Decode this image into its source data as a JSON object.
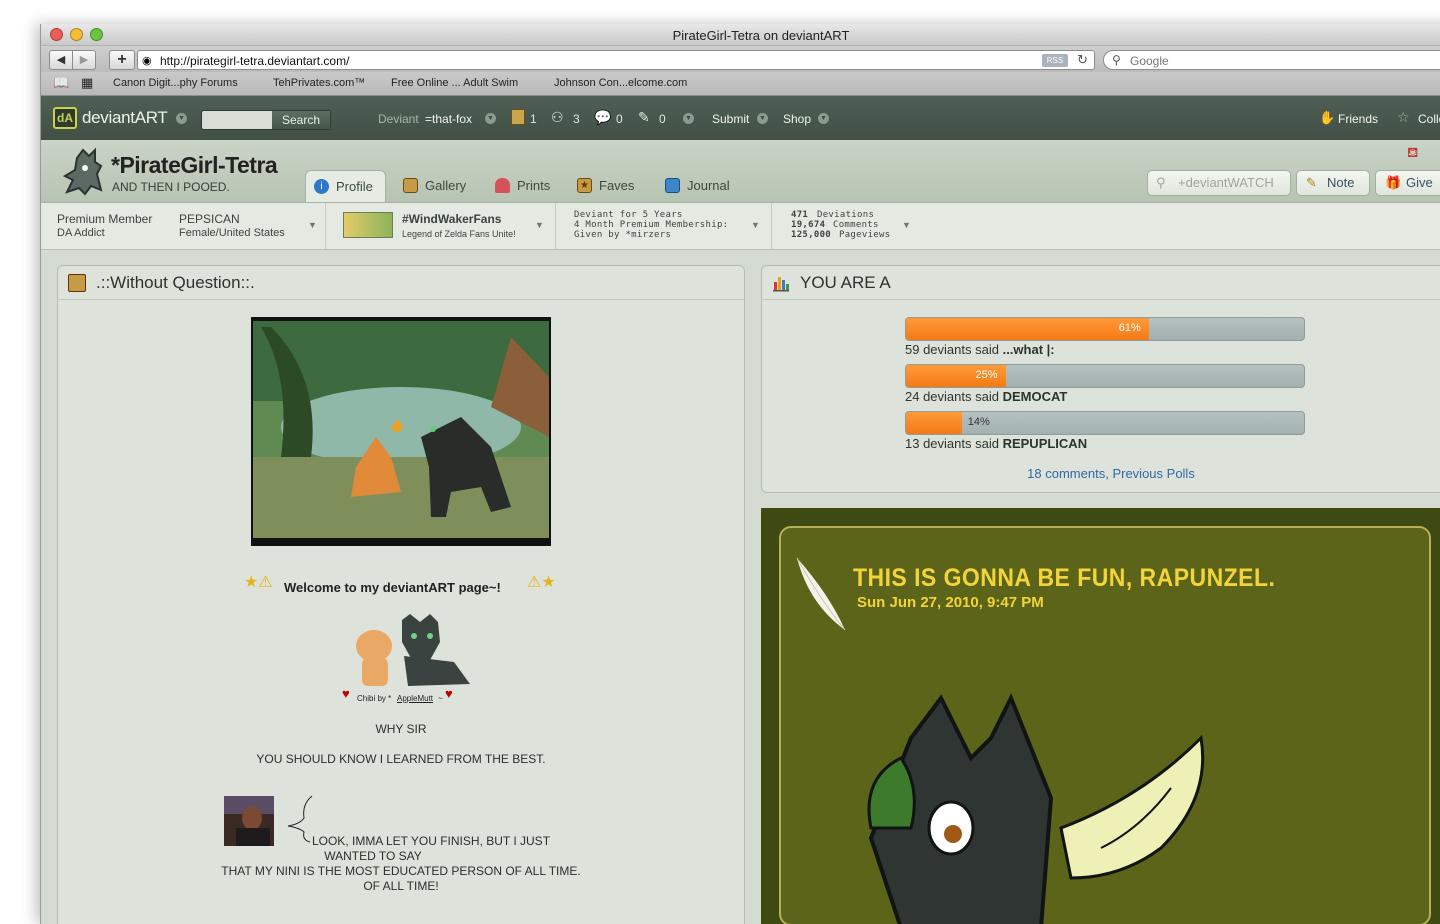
{
  "browser": {
    "title": "PirateGirl-Tetra on deviantART",
    "url": "http://pirategirl-tetra.deviantart.com/",
    "rss": "RSS",
    "search_placeholder": "Google",
    "bookmarks": [
      "Canon Digit...phy Forums",
      "TehPrivates.com™",
      "Free Online ... Adult Swim",
      "Johnson Con...elcome.com"
    ]
  },
  "dabar": {
    "logo": "deviantART",
    "search_button": "Search",
    "user_prefix": "Deviant",
    "user": "=that-fox",
    "counts": [
      "1",
      "3",
      "0",
      "0"
    ],
    "submit": "Submit",
    "shop": "Shop",
    "friends": "Friends",
    "collections": "Colle"
  },
  "profile": {
    "name": "*PirateGirl-Tetra",
    "tagline": "AND THEN I POOED.",
    "tabs": [
      "Profile",
      "Gallery",
      "Prints",
      "Faves",
      "Journal"
    ],
    "watch": "+deviantWATCH",
    "note": "Note",
    "give": "Give"
  },
  "stats": {
    "member_type": "Premium Member",
    "member_title": "DA Addict",
    "custom_title": "PEPSICAN",
    "location": "Female/United States",
    "group_name": "#WindWakerFans",
    "group_desc": "Legend of Zelda Fans Unite!",
    "deviant_years": "Deviant for 5 Years",
    "membership": "4 Month Premium Membership:",
    "given_by": "Given by *mirzers",
    "deviations": "471",
    "deviations_label": "Deviations",
    "comments": "19,674",
    "comments_label": "Comments",
    "pageviews": "125,000",
    "pageviews_label": "Pageviews"
  },
  "left_panel": {
    "title": ".::Without Question::.",
    "welcome": "Welcome to my deviantART page~!",
    "chibi_credit_prefix": "Chibi by *",
    "chibi_credit_link": "AppleMutt",
    "chibi_credit_suffix": "~",
    "line1": "WHY SIR",
    "line2": "YOU SHOULD KNOW I LEARNED FROM THE BEST.",
    "quote1": "LOOK, IMMA LET YOU FINISH, BUT I JUST",
    "quote2": "WANTED TO SAY",
    "quote3": "THAT MY NINI IS THE MOST EDUCATED PERSON OF ALL TIME.",
    "quote4": "OF ALL TIME!"
  },
  "poll": {
    "title": "YOU ARE A",
    "options": [
      {
        "pct_label": "61%",
        "value": 61,
        "count": "59 deviants said",
        "answer": "...what |:"
      },
      {
        "pct_label": "25%",
        "value": 25,
        "count": "24 deviants said",
        "answer": "DEMOCAT"
      },
      {
        "pct_label": "14%",
        "value": 14,
        "count": "13 deviants said",
        "answer": "REPUPLICAN"
      }
    ],
    "comments_link": "18 comments",
    "sep": ",",
    "previous_link": "Previous Polls"
  },
  "journal": {
    "title": "THIS IS GONNA BE FUN, RAPUNZEL.",
    "date": "Sun Jun 27, 2010, 9:47 PM"
  }
}
